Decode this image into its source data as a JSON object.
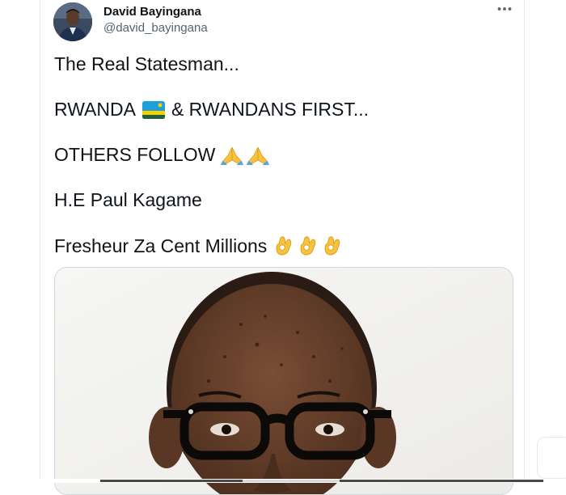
{
  "tweet": {
    "author": {
      "name": "David Bayingana",
      "handle": "@david_bayingana"
    },
    "more_icon": "more-horizontal-icon",
    "lines": [
      {
        "text": "The Real Statesman..."
      },
      {
        "text": "RWANDA",
        "emoji": "flag-rwanda",
        "after": "& RWANDANS FIRST..."
      },
      {
        "text": "OTHERS FOLLOW",
        "emoji": "folded-hands x2"
      },
      {
        "text": "H.E Paul Kagame"
      },
      {
        "text": "Fresheur Za Cent Millions",
        "emoji": "ok-hand x3"
      }
    ],
    "media": {
      "type": "photo"
    }
  },
  "colors": {
    "text": "#0f1419",
    "secondary": "#536471",
    "border": "#cfd9de",
    "emoji_yellow": "#f7c23f",
    "flag_blue": "#20a0d8",
    "flag_yellow": "#fad201",
    "flag_green": "#20603d"
  }
}
